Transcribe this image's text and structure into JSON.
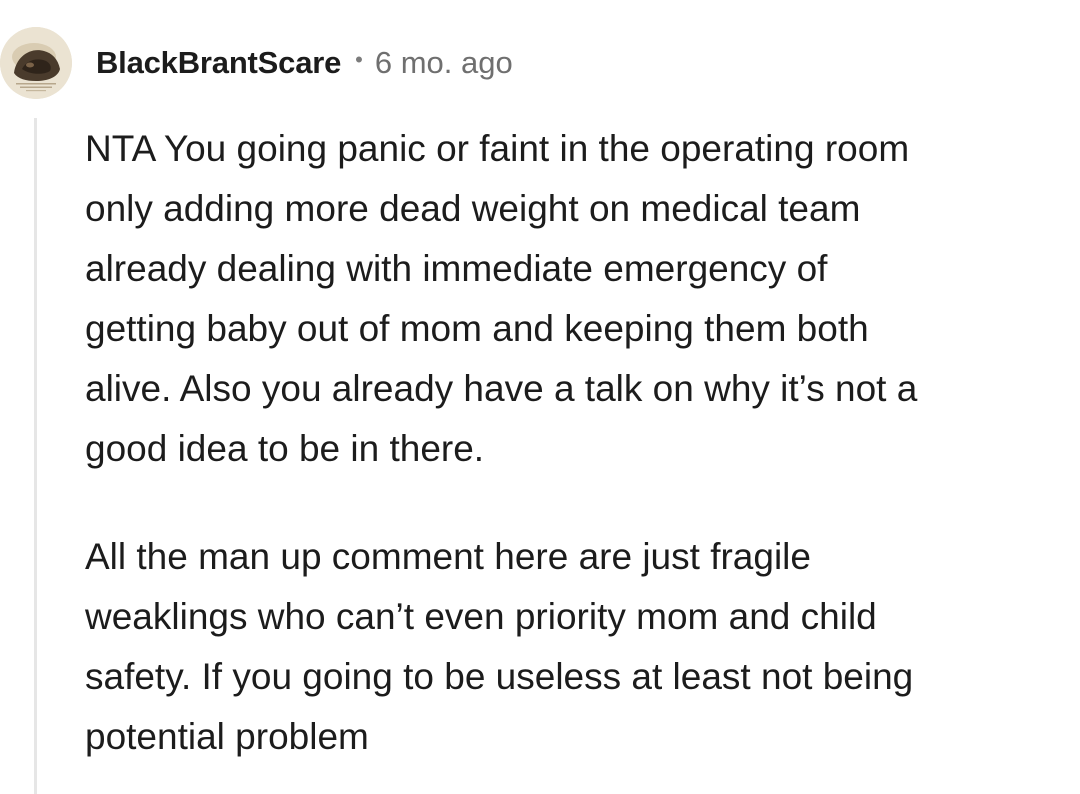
{
  "comment": {
    "author": "BlackBrantScare",
    "separator": "•",
    "time_ago": "6 mo. ago",
    "avatar_icon": "user-avatar-icon",
    "paragraphs": [
      [
        "NTA You going panic or faint in the operating room",
        "only adding more dead weight on medical team",
        "already dealing with immediate emergency of",
        "getting baby out of mom and keeping them both",
        "alive. Also you already have a talk on why it’s not a",
        "good idea to be in there."
      ],
      [
        "All the man up comment here are just fragile",
        "weaklings who can’t even priority mom and child",
        "safety. If you going to be useless at least not being",
        "potential problem"
      ]
    ]
  },
  "colors": {
    "text": "#1c1c1c",
    "meta": "#6f6f6f",
    "thread_line": "#e6e6e6",
    "background": "#ffffff"
  }
}
